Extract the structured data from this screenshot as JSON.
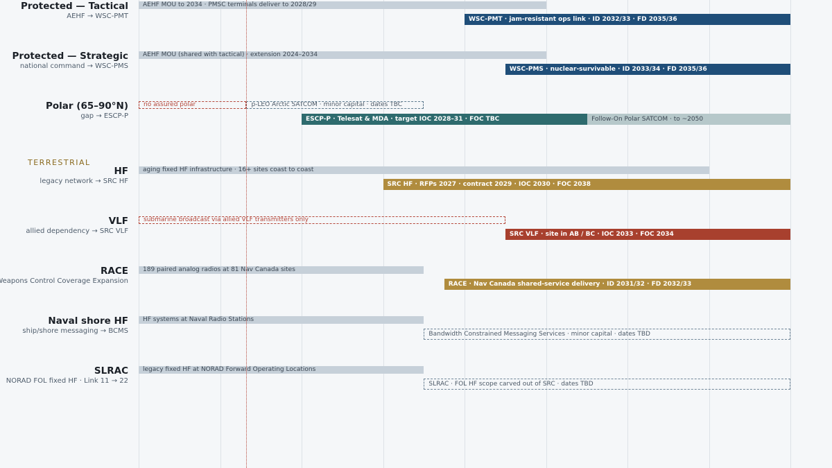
{
  "chart_data": {
    "type": "gantt",
    "year_range": [
      2024,
      2050
    ],
    "now_year": 2028.3,
    "gridline_years": [
      2024,
      2027.25,
      2030.5,
      2033.75,
      2037,
      2040.25,
      2043.5,
      2046.75,
      2050
    ],
    "sections": [
      {
        "label": "",
        "rows": [
          "protected-tactical",
          "protected-strategic",
          "polar"
        ]
      },
      {
        "label": "TERRESTRIAL",
        "rows": [
          "hf",
          "vlf",
          "race",
          "naval-shore-hf",
          "slrac"
        ]
      }
    ],
    "rows": [
      {
        "id": "protected-tactical",
        "title": "Protected — Tactical",
        "subtitle": "AEHF → WSC-PMT",
        "y": 0,
        "bars": [
          {
            "lane": 0,
            "style": "legacy",
            "start": 2024,
            "end": 2040.25,
            "label": "AEHF MOU to 2034 · PMSC terminals deliver to 2028/29"
          },
          {
            "lane": 1,
            "style": "solid",
            "color": "#1f4e79",
            "start": 2037,
            "end": 2050,
            "label": "WSC-PMT · jam-resistant ops link · ID 2032/33 · FD 2035/36"
          }
        ]
      },
      {
        "id": "protected-strategic",
        "title": "Protected — Strategic",
        "subtitle": "national command → WSC-PMS",
        "y": 1,
        "bars": [
          {
            "lane": 0,
            "style": "legacy",
            "start": 2024,
            "end": 2040.25,
            "label": "AEHF MOU (shared with tactical) · extension 2024–2034"
          },
          {
            "lane": 1,
            "style": "solid",
            "color": "#1f4e79",
            "start": 2038.63,
            "end": 2050,
            "label": "WSC-PMS · nuclear-survivable · ID 2033/34 · FD 2035/36"
          }
        ]
      },
      {
        "id": "polar",
        "title": "Polar (65–90°N)",
        "subtitle": "gap → ESCP-P",
        "y": 2,
        "bars": [
          {
            "lane": 0,
            "style": "gap",
            "start": 2024,
            "end": 2028.3,
            "label": "no assured polar"
          },
          {
            "lane": 0,
            "style": "dashed",
            "start": 2028.3,
            "end": 2035.38,
            "label": "p-LEO Arctic SATCOM · minor capital · dates TBC"
          },
          {
            "lane": 1,
            "style": "solid",
            "color": "#2e6b6e",
            "start": 2030.5,
            "end": 2041.9,
            "label": "ESCP-P · Telesat & MDA · target IOC 2028–31 · FOC TBC"
          },
          {
            "lane": 1,
            "style": "followon",
            "start": 2041.9,
            "end": 2050,
            "label": "Follow-On Polar SATCOM · to ~2050"
          }
        ]
      },
      {
        "id": "hf",
        "title": "HF",
        "subtitle": "legacy network → SRC HF",
        "y": 3.3,
        "bars": [
          {
            "lane": 0,
            "style": "legacy",
            "start": 2024,
            "end": 2046.75,
            "label": "aging fixed HF infrastructure · 16+ sites coast to coast"
          },
          {
            "lane": 1,
            "style": "solid",
            "color": "#b08c3e",
            "start": 2033.75,
            "end": 2050,
            "label": "SRC HF · RFPs 2027 · contract 2029 · IOC 2030 · FOC 2038"
          }
        ]
      },
      {
        "id": "vlf",
        "title": "VLF",
        "subtitle": "allied dependency → SRC VLF",
        "y": 4.3,
        "bars": [
          {
            "lane": 0,
            "style": "gap",
            "start": 2024,
            "end": 2038.63,
            "label": "submarine broadcast via allied VLF transmitters only"
          },
          {
            "lane": 1,
            "style": "solid",
            "color": "#a8402e",
            "start": 2038.63,
            "end": 2050,
            "label": "SRC VLF · site in AB / BC · IOC 2033 · FOC 2034"
          }
        ]
      },
      {
        "id": "race",
        "title": "RACE",
        "subtitle": "Weapons Control Coverage Expansion",
        "y": 5.3,
        "bars": [
          {
            "lane": 0,
            "style": "legacy",
            "start": 2024,
            "end": 2035.38,
            "label": "189 paired analog radios at 81 Nav Canada sites"
          },
          {
            "lane": 1,
            "style": "solid",
            "color": "#b08c3e",
            "start": 2036.19,
            "end": 2050,
            "label": "RACE · Nav Canada shared-service delivery · ID 2031/32 · FD 2032/33"
          }
        ]
      },
      {
        "id": "naval-shore-hf",
        "title": "Naval shore HF",
        "subtitle": "ship/shore messaging → BCMS",
        "y": 6.3,
        "bars": [
          {
            "lane": 0,
            "style": "legacy",
            "start": 2024,
            "end": 2035.38,
            "label": "HF systems at Naval Radio Stations"
          },
          {
            "lane": 1,
            "style": "dashed",
            "start": 2035.38,
            "end": 2050,
            "label": "Bandwidth Constrained Messaging Services · minor capital · dates TBD"
          }
        ]
      },
      {
        "id": "slrac",
        "title": "SLRAC",
        "subtitle": "NORAD FOL fixed HF · Link 11 → 22",
        "y": 7.3,
        "bars": [
          {
            "lane": 0,
            "style": "legacy",
            "start": 2024,
            "end": 2035.38,
            "label": "legacy fixed HF at NORAD Forward Operating Locations"
          },
          {
            "lane": 1,
            "style": "dashed",
            "start": 2035.38,
            "end": 2050,
            "label": "SLRAC · FOL HF scope carved out of SRC · dates TBD"
          }
        ]
      }
    ]
  }
}
